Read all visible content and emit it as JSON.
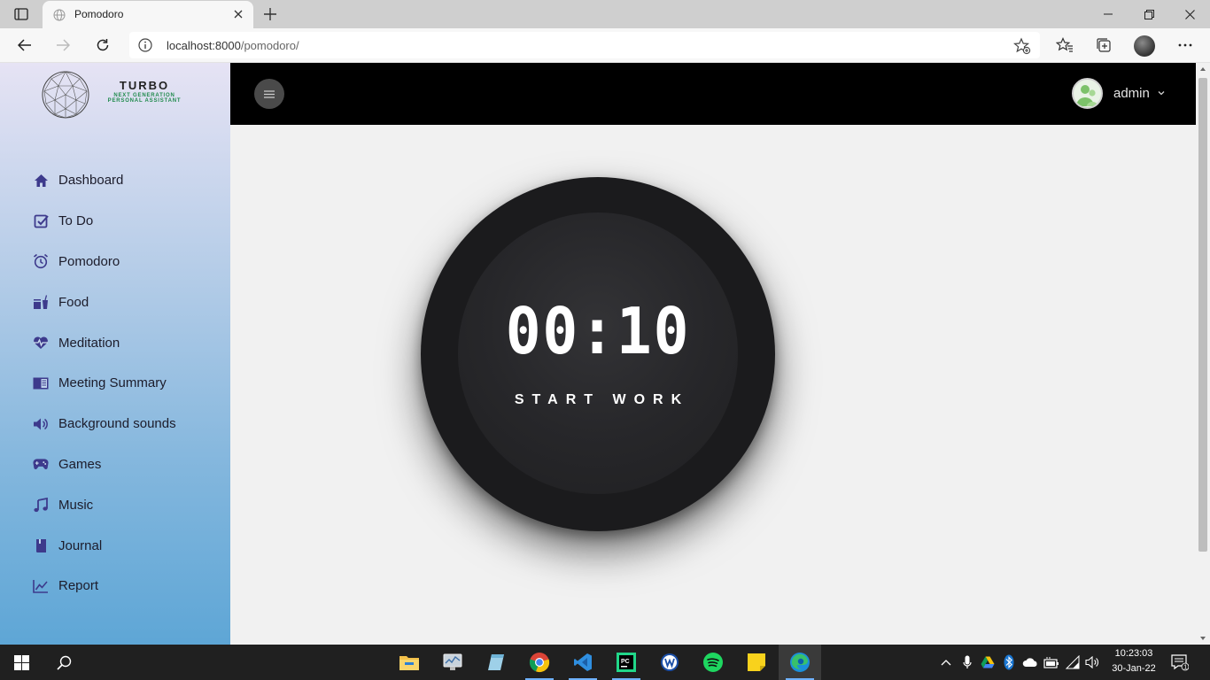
{
  "browser": {
    "tab_title": "Pomodoro",
    "url_host": "localhost:8000",
    "url_path": "/pomodoro/"
  },
  "sidebar": {
    "brand_title": "TURBO",
    "brand_sub_line1": "NEXT GENERATION",
    "brand_sub_line2": "PERSONAL ASSISTANT",
    "items": [
      {
        "label": "Dashboard",
        "icon": "home-icon"
      },
      {
        "label": "To Do",
        "icon": "checkbox-icon"
      },
      {
        "label": "Pomodoro",
        "icon": "alarm-clock-icon"
      },
      {
        "label": "Food",
        "icon": "food-icon"
      },
      {
        "label": "Meditation",
        "icon": "heartbeat-icon"
      },
      {
        "label": "Meeting Summary",
        "icon": "book-open-icon"
      },
      {
        "label": "Background sounds",
        "icon": "volume-icon"
      },
      {
        "label": "Games",
        "icon": "gamepad-icon"
      },
      {
        "label": "Music",
        "icon": "music-note-icon"
      },
      {
        "label": "Journal",
        "icon": "journal-icon"
      },
      {
        "label": "Report",
        "icon": "chart-line-icon"
      }
    ]
  },
  "header": {
    "username": "admin"
  },
  "timer": {
    "time": "00:10",
    "label": "START WORK"
  },
  "taskbar": {
    "time": "10:23:03",
    "date": "30-Jan-22",
    "notification_count": "1"
  },
  "colors": {
    "icon_purple": "#3d3a8c",
    "header_bg": "#000000",
    "timer_bg": "#1b1b1d",
    "brand_green": "#1f8a4c"
  }
}
